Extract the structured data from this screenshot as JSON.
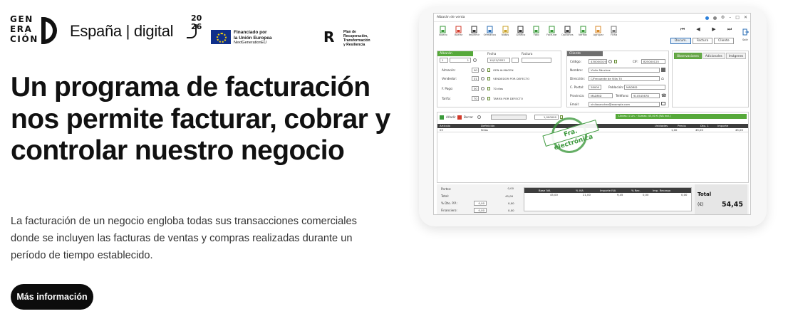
{
  "logos": {
    "generacion": [
      "GEN",
      "ERA",
      "CIÓN"
    ],
    "espana_digital": "España | digital",
    "year_top": "20",
    "year_bottom": "26",
    "eu_line1": "Financiado por",
    "eu_line2": "la Unión Europea",
    "eu_line3": "NextGenerationEU",
    "prtr_line1": "Plan de",
    "prtr_line2": "Recuperación,",
    "prtr_line3": "Transformación",
    "prtr_line4": "y Resiliencia"
  },
  "hero": {
    "headline": "Un programa de facturación nos permite facturar, cobrar y controlar nuestro negocio",
    "description": "La facturación de un negocio engloba todas sus transacciones comerciales donde se incluyen las facturas de ventas y compras realizadas durante un período de tiempo establecido.",
    "cta_label": "Más información"
  },
  "app": {
    "window_title": "Albarán de venta",
    "toolbar": [
      {
        "label": "Nuevo",
        "icon": "new-doc-icon",
        "color": "#3a9a3a"
      },
      {
        "label": "Borrar",
        "icon": "delete-doc-icon",
        "color": "#d23a2a"
      },
      {
        "label": "Imprimir",
        "icon": "printer-icon",
        "color": "#333333"
      },
      {
        "label": "Ofimática",
        "icon": "office-doc-icon",
        "color": "#2a6db5"
      },
      {
        "label": "Notas",
        "icon": "notes-icon",
        "color": "#c9a227"
      },
      {
        "label": "Gráfico",
        "icon": "chart-icon",
        "color": "#333333"
      },
      {
        "label": "Foto",
        "icon": "photo-icon",
        "color": "#3a9a3a"
      },
      {
        "label": "Facturar",
        "icon": "invoice-icon",
        "color": "#3a9a3a"
      },
      {
        "label": "Opciones",
        "icon": "gear-icon",
        "color": "#333333"
      },
      {
        "label": "Verifac",
        "icon": "verify-icon",
        "color": "#3a9a3a"
      },
      {
        "label": "Agrupar",
        "icon": "group-icon",
        "color": "#d88a2a"
      },
      {
        "label": "Ficha",
        "icon": "card-icon",
        "color": "#777777"
      }
    ],
    "exit_label": "Salir",
    "nav_tabs": [
      "Docum.",
      "Factura",
      "Cliente"
    ],
    "albaran": {
      "header": "Albarán",
      "fecha_label": "Fecha",
      "factura_label": "Factura",
      "serie": "1",
      "numero": "1",
      "fecha": "10/12/2022",
      "almacen_label": "Almacén:",
      "almacen_code": "00",
      "almacen_name": "GEN ALMACEN",
      "vendedor_label": "Vendedor:",
      "vendedor_code": "01",
      "vendedor_name": "VENDEDOR POR DEFECTO",
      "fpago_label": "F. Pago:",
      "fpago_code": "00",
      "fpago_name": "70 días",
      "tarifa_label": "Tarifa:",
      "tarifa_code": "T0",
      "tarifa_name": "TARIFA POR DEFECTO"
    },
    "cliente": {
      "header": "Cliente",
      "codigo_label": "Código:",
      "codigo": "430000019",
      "cif_label": "CIF:",
      "cif": "B25000125",
      "nombre_label": "Nombre:",
      "nombre": "Vinilo Sánchez",
      "direccion_label": "Dirección:",
      "direccion": "C/Frecuente de Villa 70",
      "cpostal_label": "C. Postal:",
      "cpostal": "28000",
      "poblacion_label": "Población:",
      "poblacion": "MADRID",
      "provincia_label": "Provincia:",
      "provincia": "MADRID",
      "telefono_label": "Teléfono:",
      "telefono": "910545678",
      "email_label": "Email:",
      "email": "vinilosanchez@example.com"
    },
    "right_tabs": [
      "Observaciones",
      "Adicionales",
      "Imágenes"
    ],
    "lines": {
      "add_label": "Añadir",
      "delete_label": "Borrar",
      "quantity": "1,000000",
      "status": "Líneas: 1 Lín. · Sumas: 45,00 € (IVA incl.)",
      "columns": [
        "Artículo",
        "Definición",
        "Unidades",
        "Precio",
        "Dto. 1",
        "Importe"
      ],
      "rows": [
        {
          "articulo": "03",
          "definicion": "Sillas",
          "unidades": "1,00",
          "precio": "45,00",
          "dto": "",
          "importe": "45,00"
        }
      ]
    },
    "stamp_text": "Fra. electrónica",
    "footer": {
      "portes_label": "Portes:",
      "portes": "0,00",
      "total_label": "Total:",
      "total": "45,00",
      "dto_pp_label": "% Dto. P.P.:",
      "dto_pp_pct": "0,00",
      "dto_pp": "0,00",
      "financiero_label": "Financiero:",
      "financiero_pct": "0,00",
      "financiero": "0,00",
      "tax_columns": [
        "Base IVA",
        "% IVA",
        "Importe IVA",
        "% Rec.",
        "Imp. Recargo"
      ],
      "tax_values": [
        "45,00",
        "21,00",
        "9,45",
        "0,00",
        "0,00"
      ],
      "total_title": "Total",
      "total_currency": "(€)",
      "total_value": "54,45"
    }
  },
  "colors": {
    "accent_green": "#56a93a",
    "cta_bg": "#0c0c0c",
    "dark_header": "#3d3d3d"
  }
}
